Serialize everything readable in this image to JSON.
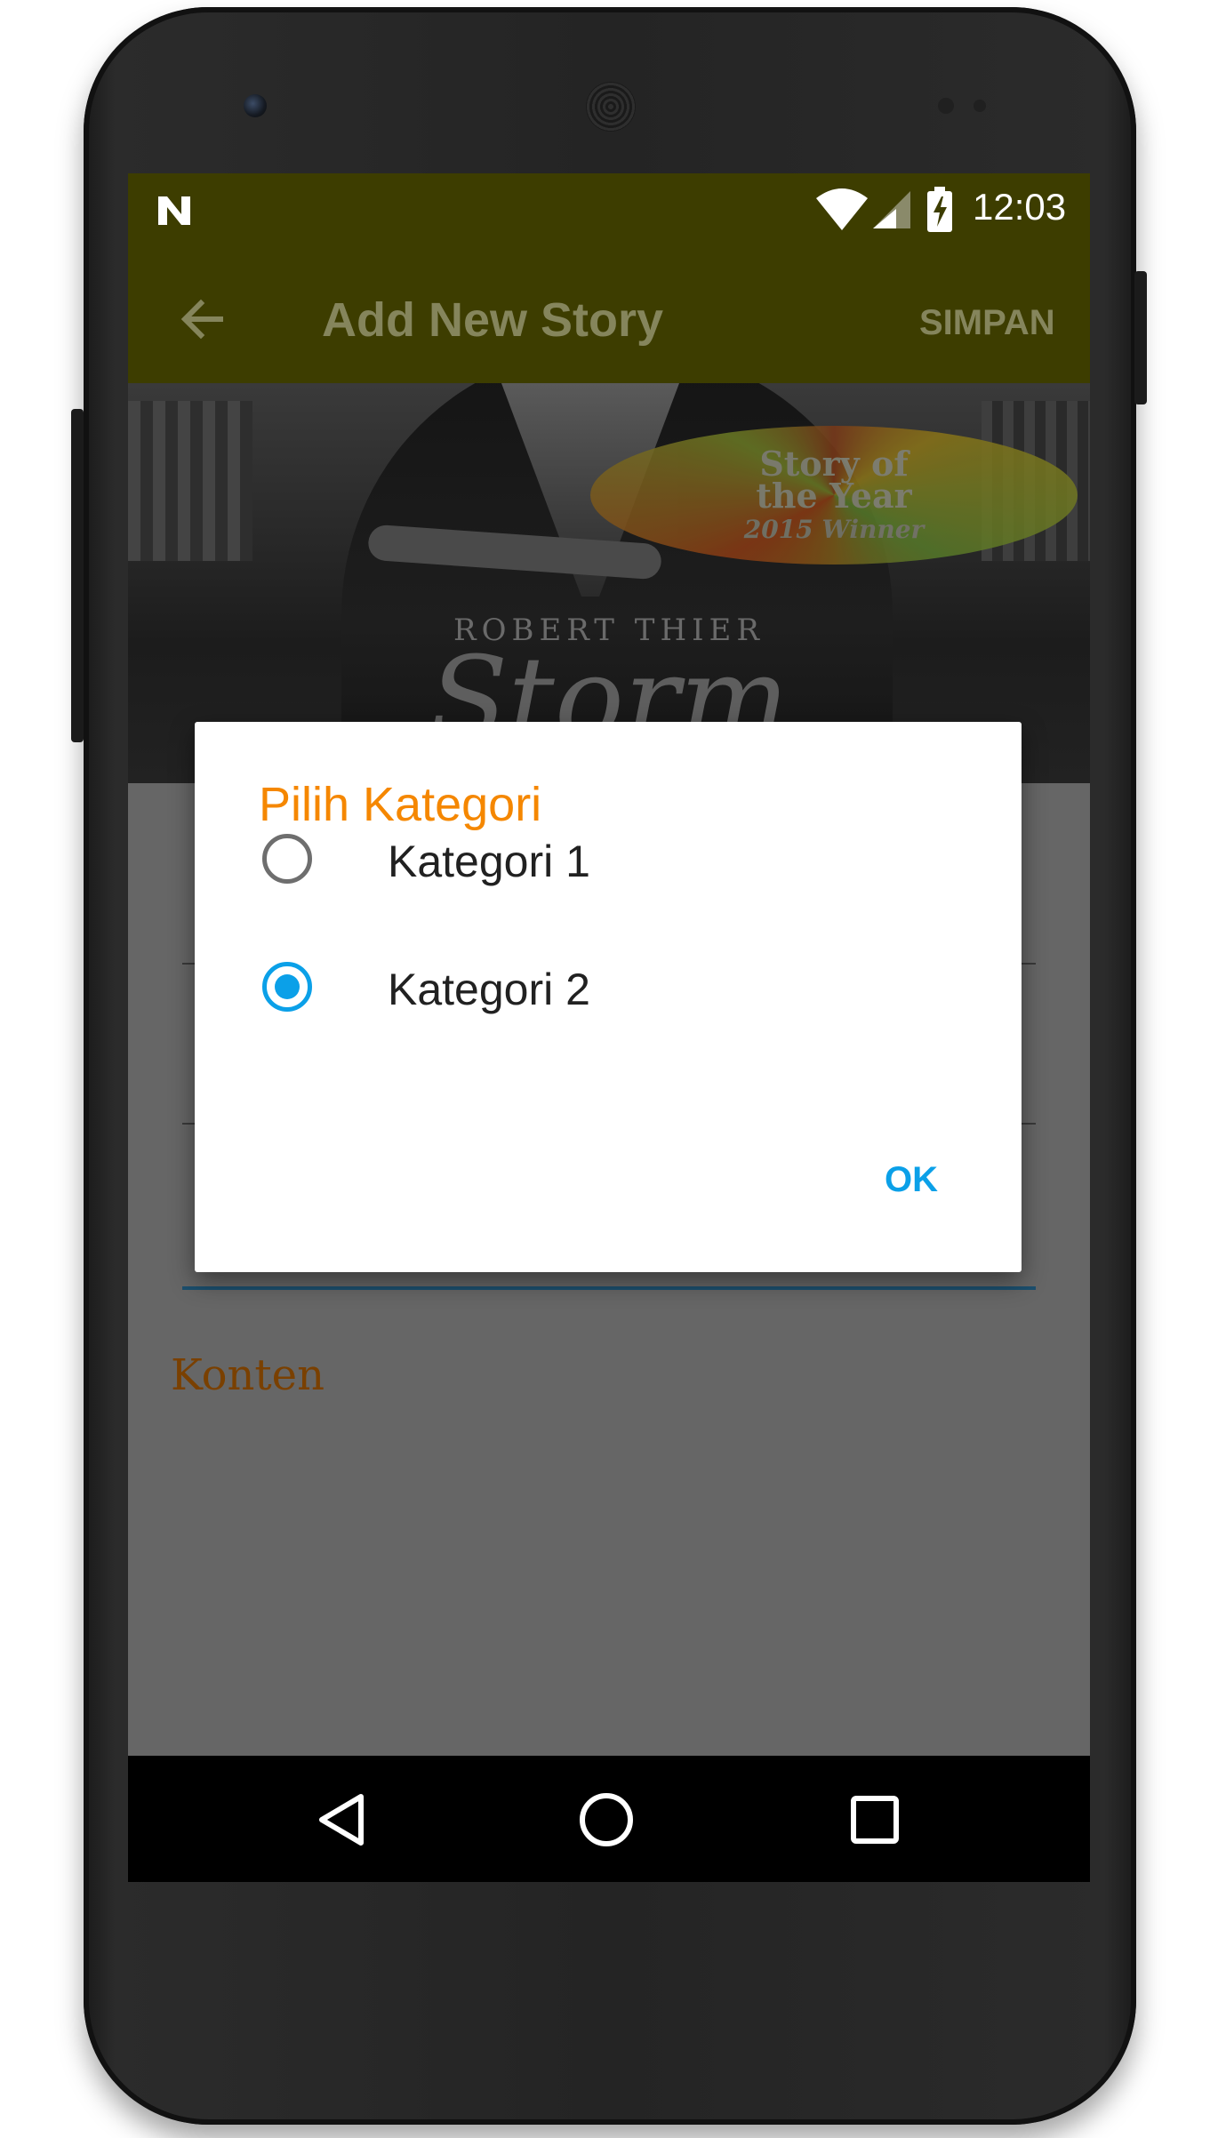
{
  "status_bar": {
    "time": "12:03"
  },
  "app_bar": {
    "title": "Add New Story",
    "back_icon": "arrow-left-icon",
    "action_label": "SIMPAN"
  },
  "cover_image": {
    "badge_line1": "Story of",
    "badge_line2": "the Year",
    "badge_line3": "2015 Winner",
    "author": "ROBERT THIER",
    "title_text": "Storm"
  },
  "form": {
    "content_label": "Konten"
  },
  "dialog": {
    "title": "Pilih Kategori",
    "options": [
      {
        "label": "Kategori 1",
        "selected": false
      },
      {
        "label": "Kategori 2",
        "selected": true
      }
    ],
    "ok_label": "OK"
  },
  "colors": {
    "toolbar": "#3d3d00",
    "accent": "#0ba0e8",
    "dialog_title": "#f58700",
    "content_label": "#7a4000"
  },
  "nav_bar": {
    "back": "back-triangle-icon",
    "home": "home-circle-icon",
    "recents": "recents-square-icon"
  }
}
